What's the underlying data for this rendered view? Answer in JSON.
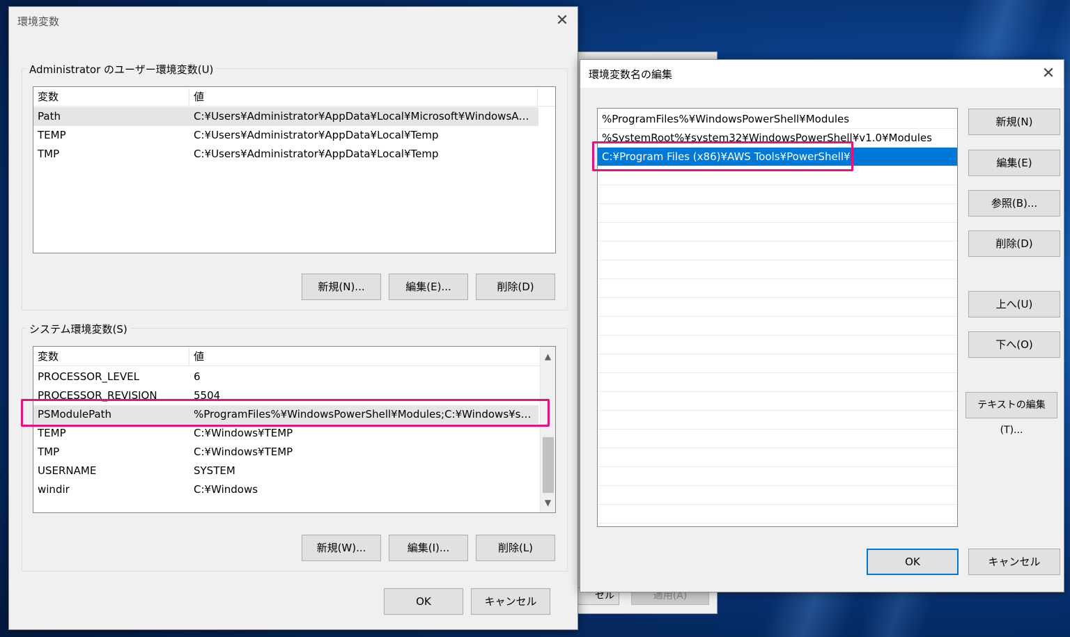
{
  "env_dialog": {
    "title": "環境変数",
    "user_group": {
      "label": "Administrator のユーザー環境変数(U)",
      "col_var": "変数",
      "col_val": "値",
      "rows": [
        {
          "name": "Path",
          "value": "C:¥Users¥Administrator¥AppData¥Local¥Microsoft¥WindowsAp..."
        },
        {
          "name": "TEMP",
          "value": "C:¥Users¥Administrator¥AppData¥Local¥Temp"
        },
        {
          "name": "TMP",
          "value": "C:¥Users¥Administrator¥AppData¥Local¥Temp"
        }
      ],
      "new_label": "新規(N)...",
      "edit_label": "編集(E)...",
      "delete_label": "削除(D)"
    },
    "system_group": {
      "label": "システム環境変数(S)",
      "col_var": "変数",
      "col_val": "値",
      "rows": [
        {
          "name": "PROCESSOR_LEVEL",
          "value": "6"
        },
        {
          "name": "PROCESSOR_REVISION",
          "value": "5504"
        },
        {
          "name": "PSModulePath",
          "value": "%ProgramFiles%¥WindowsPowerShell¥Modules;C:¥Windows¥sy..."
        },
        {
          "name": "TEMP",
          "value": "C:¥Windows¥TEMP"
        },
        {
          "name": "TMP",
          "value": "C:¥Windows¥TEMP"
        },
        {
          "name": "USERNAME",
          "value": "SYSTEM"
        },
        {
          "name": "windir",
          "value": "C:¥Windows"
        }
      ],
      "new_label": "新規(W)...",
      "edit_label": "編集(I)...",
      "delete_label": "削除(L)"
    },
    "ok_label": "OK",
    "cancel_label": "キャンセル"
  },
  "edit_dialog": {
    "title": "環境変数名の編集",
    "entries": [
      "%ProgramFiles%¥WindowsPowerShell¥Modules",
      "%SystemRoot%¥system32¥WindowsPowerShell¥v1.0¥Modules",
      "C:¥Program Files (x86)¥AWS Tools¥PowerShell¥"
    ],
    "selected_index": 2,
    "buttons": {
      "new": "新規(N)",
      "edit": "編集(E)",
      "browse": "参照(B)...",
      "delete": "削除(D)",
      "up": "上へ(U)",
      "down": "下へ(O)",
      "edit_text": "テキストの編集(T)..."
    },
    "ok_label": "OK",
    "cancel_label": "キャンセル"
  },
  "behind_dialog": {
    "cancel_partial": "セル",
    "apply_partial": "適用(A)"
  },
  "colors": {
    "highlight": "#e8117f",
    "selection": "#0078d7"
  }
}
